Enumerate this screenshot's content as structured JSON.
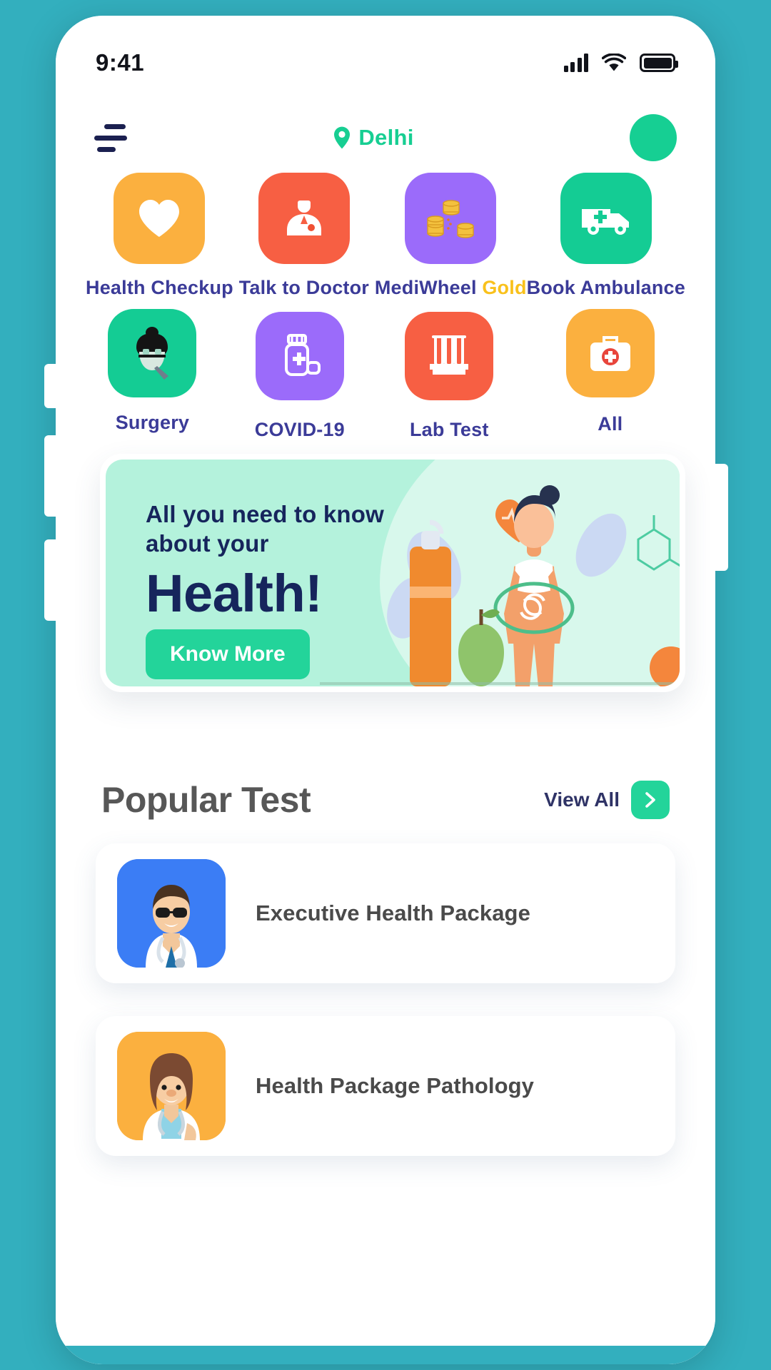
{
  "theme": {
    "page_background": "#33AFBE",
    "accent_green": "#23D49A",
    "label_indigo": "#3B3B98",
    "gold": "#F9C11C",
    "banner_mint": "#B4F2DC",
    "banner_navy": "#16255C"
  },
  "status_bar": {
    "time": "9:41",
    "signal_icon": "cellular-signal-icon",
    "wifi_icon": "wifi-icon",
    "battery_icon": "battery-full-icon"
  },
  "header": {
    "menu_icon": "hamburger-menu-icon",
    "location_icon": "location-pin-icon",
    "location": "Delhi",
    "avatar": "profile-avatar"
  },
  "quick_actions": [
    {
      "label": "Health Checkup",
      "label_suffix": "",
      "icon": "heart-icon",
      "tile_color": "#FBB03F",
      "icon_color": "#FFFFFF"
    },
    {
      "label": "Talk to Doctor",
      "label_suffix": "",
      "icon": "doctor-icon",
      "tile_color": "#F75F43",
      "icon_color": "#FFFFFF"
    },
    {
      "label": "MediWheel",
      "label_suffix": "Gold",
      "icon": "coins-icon",
      "tile_color": "#9B6BFA",
      "icon_color": "#F4C140"
    },
    {
      "label": "Book Ambulance",
      "label_suffix": "",
      "icon": "ambulance-icon",
      "tile_color": "#14CC94",
      "icon_color": "#FFFFFF"
    },
    {
      "label": "Surgery",
      "label_suffix": "",
      "icon": "surgeon-face-icon",
      "tile_color": "#14CC94",
      "icon_color": "#1B1B1B"
    },
    {
      "label": "COVID-19",
      "label_suffix": "",
      "icon": "medicine-bottle-icon",
      "tile_color": "#9B6BFA",
      "icon_color": "#FFFFFF"
    },
    {
      "label": "Lab Test",
      "label_suffix": "",
      "icon": "test-tubes-icon",
      "tile_color": "#F75F43",
      "icon_color": "#FFFFFF"
    },
    {
      "label": "All",
      "label_suffix": "",
      "icon": "first-aid-kit-icon",
      "tile_color": "#FBB03F",
      "icon_color": "#FFFFFF"
    }
  ],
  "banner": {
    "subtitle_line1": "All you need to know",
    "subtitle_line2": "about your",
    "title": "Health!",
    "cta_label": "Know More",
    "illustration": "woman-health-illustration"
  },
  "popular_section": {
    "title": "Popular Test",
    "view_all_label": "View All",
    "arrow_icon": "chevron-right-icon"
  },
  "popular_tests": [
    {
      "name": "Executive Health Package",
      "thumb": "male-doctor-avatar",
      "thumb_color": "#3B7DF5"
    },
    {
      "name": "Health Package Pathology",
      "thumb": "female-doctor-avatar",
      "thumb_color": "#FBB03F"
    }
  ]
}
